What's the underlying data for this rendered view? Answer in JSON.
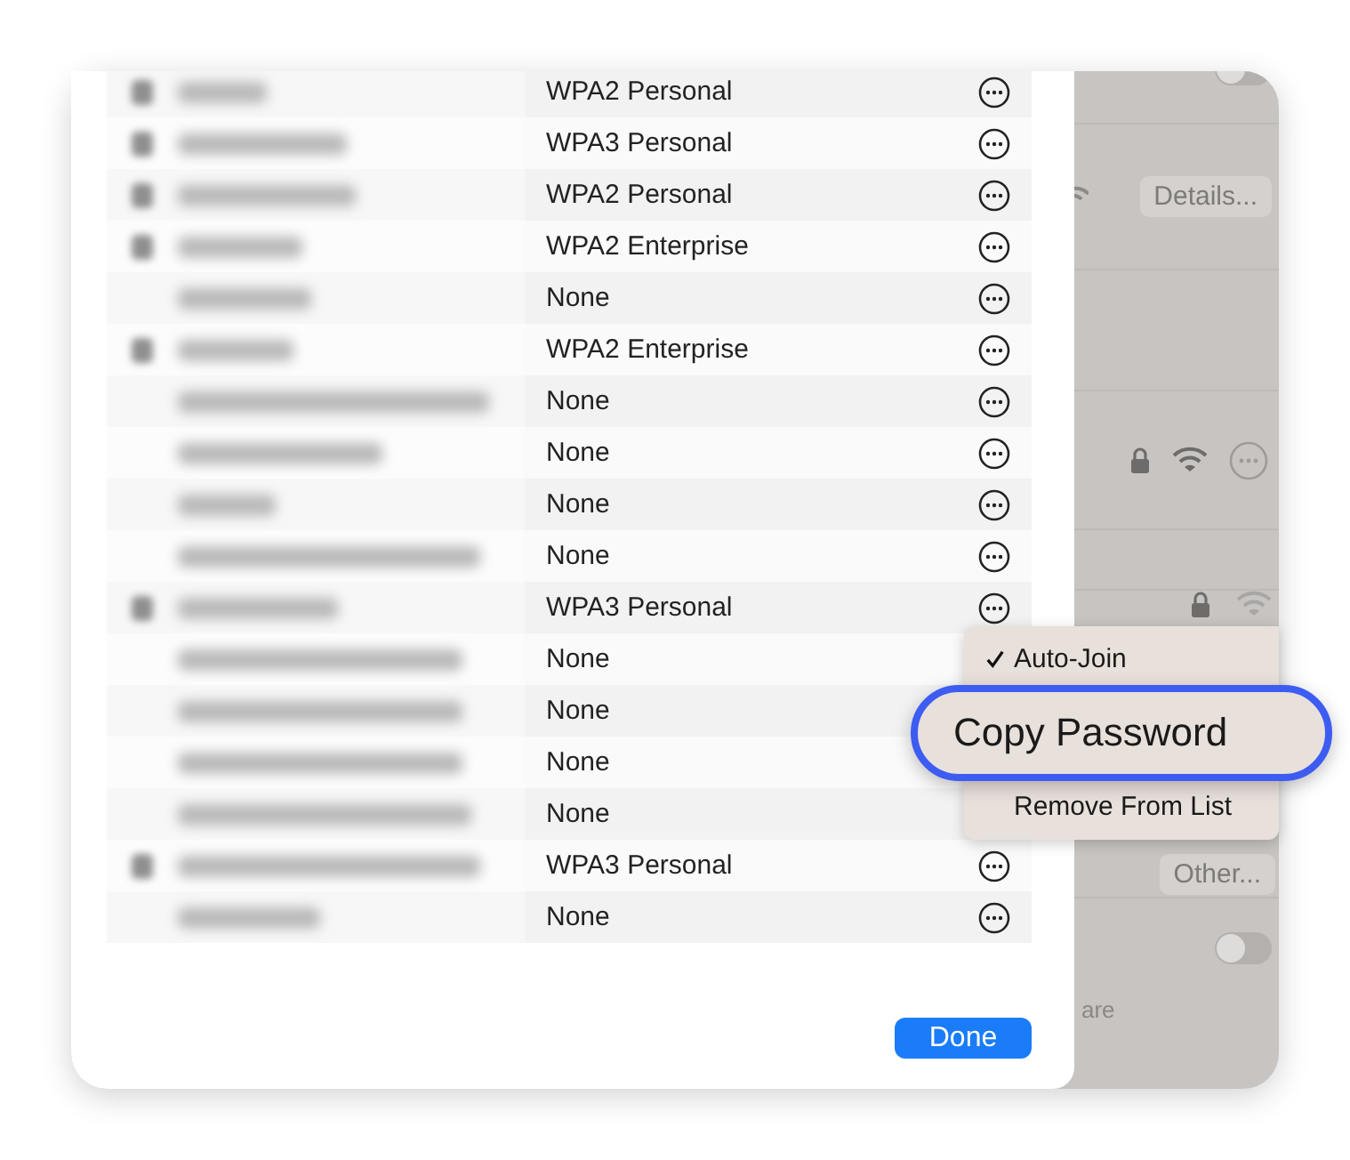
{
  "networks": [
    {
      "locked": true,
      "security": "WPA2 Personal"
    },
    {
      "locked": true,
      "security": "WPA3 Personal"
    },
    {
      "locked": true,
      "security": "WPA2 Personal"
    },
    {
      "locked": true,
      "security": "WPA2 Enterprise"
    },
    {
      "locked": false,
      "security": "None"
    },
    {
      "locked": true,
      "security": "WPA2 Enterprise"
    },
    {
      "locked": false,
      "security": "None"
    },
    {
      "locked": false,
      "security": "None"
    },
    {
      "locked": false,
      "security": "None"
    },
    {
      "locked": false,
      "security": "None"
    },
    {
      "locked": true,
      "security": "WPA3 Personal",
      "context_menu": [
        {
          "label": "Auto-Join",
          "checked": true,
          "highlighted": false
        },
        {
          "label": "Copy Password",
          "checked": false,
          "highlighted": true
        },
        {
          "label": "Remove From List",
          "checked": false,
          "highlighted": false
        }
      ]
    },
    {
      "locked": false,
      "security": "None"
    },
    {
      "locked": false,
      "security": "None"
    },
    {
      "locked": false,
      "security": "None"
    },
    {
      "locked": false,
      "security": "None"
    },
    {
      "locked": true,
      "security": "WPA3 Personal"
    },
    {
      "locked": false,
      "security": "None"
    }
  ],
  "done_button": "Done",
  "background": {
    "details_button": "Details...",
    "other_button": "Other...",
    "footer_text": "are",
    "top_toggle_on": false,
    "bottom_toggle_on": false
  }
}
